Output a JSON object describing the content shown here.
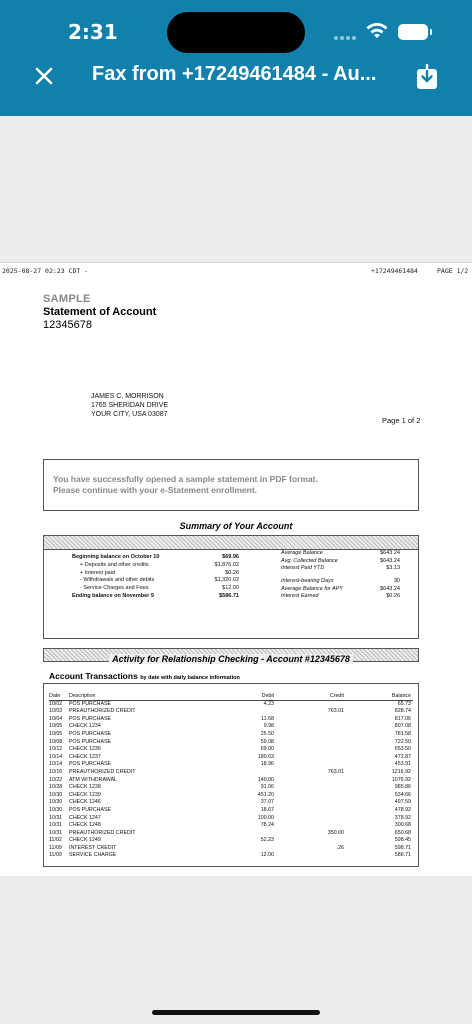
{
  "status_bar": {
    "time": "2:31"
  },
  "header": {
    "title": "Fax from +17249461484 - Au..."
  },
  "fax_header": {
    "left": "2025-08-27 02:23 CDT -",
    "sender": "+17249461484",
    "page": "PAGE 1/2"
  },
  "statement": {
    "sample_label": "SAMPLE",
    "title": "Statement of Account",
    "account_number": "12345678",
    "address": [
      "JAMES C. MORRISON",
      "1765 SHERIDAN DRIVE",
      "YOUR CITY, USA 03087"
    ],
    "page_of": "Page 1 of 2",
    "notice_line1": "You have successfully opened a sample statement in PDF format.",
    "notice_line2": "Please continue with your e-Statement enrollment."
  },
  "summary": {
    "title": "Summary of Your Account",
    "left": [
      {
        "label": "Beginning balance on October 10",
        "value": "$69.96"
      },
      {
        "label": "+ Deposits and other credits",
        "value": "$1,876.02"
      },
      {
        "label": "+ Interest paid",
        "value": "$0.26"
      },
      {
        "label": "- Withdrawals and other debits",
        "value": "$1,320.02"
      },
      {
        "label": "- Service Charges and Fees",
        "value": "$12.00"
      },
      {
        "label": "Ending balance on November 9",
        "value": "$586.71"
      }
    ],
    "right": [
      {
        "label": "Average Balance",
        "value": "$643.24"
      },
      {
        "label": "Avg. Collected Balance",
        "value": "$643.24"
      },
      {
        "label": "Interest Paid YTD",
        "value": "$3.13"
      },
      {
        "label": "Interest-bearing Days",
        "value": "30"
      },
      {
        "label": "Average Balance for APY",
        "value": "$643.24"
      },
      {
        "label": "Interest Earned",
        "value": "$0.26"
      }
    ]
  },
  "activity": {
    "bar_title": "Activity for Relationship Checking - Account #12345678",
    "section_title": "Account Transactions",
    "section_subtitle": "by date with daily balance information",
    "columns": {
      "date": "Date",
      "description": "Description",
      "debit": "Debit",
      "credit": "Credit",
      "balance": "Balance"
    },
    "rows": [
      {
        "date": "10/02",
        "desc": "POS PURCHASE",
        "debit": "4.23",
        "credit": "",
        "balance": "65.73"
      },
      {
        "date": "10/03",
        "desc": "PREAUTHORIZED CREDIT",
        "debit": "",
        "credit": "763.01",
        "balance": "828.74"
      },
      {
        "date": "10/04",
        "desc": "POS PURCHASE",
        "debit": "11.68",
        "credit": "",
        "balance": "817.06"
      },
      {
        "date": "10/05",
        "desc": "CHECK 1234",
        "debit": "9.98",
        "credit": "",
        "balance": "807.08"
      },
      {
        "date": "10/05",
        "desc": "POS PURCHASE",
        "debit": "25.50",
        "credit": "",
        "balance": "781.58"
      },
      {
        "date": "10/08",
        "desc": "POS PURCHASE",
        "debit": "59.08",
        "credit": "",
        "balance": "722.50"
      },
      {
        "date": "10/12",
        "desc": "CHECK 1236",
        "debit": "69.00",
        "credit": "",
        "balance": "653.50"
      },
      {
        "date": "10/14",
        "desc": "CHECK 1237",
        "debit": "180.63",
        "credit": "",
        "balance": "472.87"
      },
      {
        "date": "10/14",
        "desc": "POS PURCHASE",
        "debit": "18.96",
        "credit": "",
        "balance": "453.91"
      },
      {
        "date": "10/16",
        "desc": "PREAUTHORIZED CREDIT",
        "debit": "",
        "credit": "763.01",
        "balance": "1216.92"
      },
      {
        "date": "10/22",
        "desc": "ATM WITHDRAWAL",
        "debit": "140.00",
        "credit": "",
        "balance": "1076.92"
      },
      {
        "date": "10/28",
        "desc": "CHECK 1238",
        "debit": "91.06",
        "credit": "",
        "balance": "985.86"
      },
      {
        "date": "10/30",
        "desc": "CHECK 1239",
        "debit": "451.20",
        "credit": "",
        "balance": "534.66"
      },
      {
        "date": "10/30",
        "desc": "CHECK 1246",
        "debit": "37.07",
        "credit": "",
        "balance": "497.59"
      },
      {
        "date": "10/30",
        "desc": "POS PURCHASE",
        "debit": "18.67",
        "credit": "",
        "balance": "478.92"
      },
      {
        "date": "10/31",
        "desc": "CHECK 1247",
        "debit": "100.00",
        "credit": "",
        "balance": "378.92"
      },
      {
        "date": "10/31",
        "desc": "CHECK 1248",
        "debit": "78.24",
        "credit": "",
        "balance": "300.68"
      },
      {
        "date": "10/31",
        "desc": "PREAUTHORIZED CREDIT",
        "debit": "",
        "credit": "350.00",
        "balance": "650.68"
      },
      {
        "date": "11/02",
        "desc": "CHECK 1249",
        "debit": "52.23",
        "credit": "",
        "balance": "598.45"
      },
      {
        "date": "11/09",
        "desc": "INTEREST CREDIT",
        "debit": "",
        "credit": ".26",
        "balance": "598.71"
      },
      {
        "date": "11/09",
        "desc": "SERVICE CHARGE",
        "debit": "12.00",
        "credit": "",
        "balance": "586.71"
      }
    ]
  },
  "colors": {
    "header_bg": "#1280ad",
    "viewer_bg": "#ececec"
  },
  "icons": {
    "close": "close-icon",
    "download": "download-icon",
    "wifi": "wifi-icon",
    "battery": "battery-icon"
  }
}
